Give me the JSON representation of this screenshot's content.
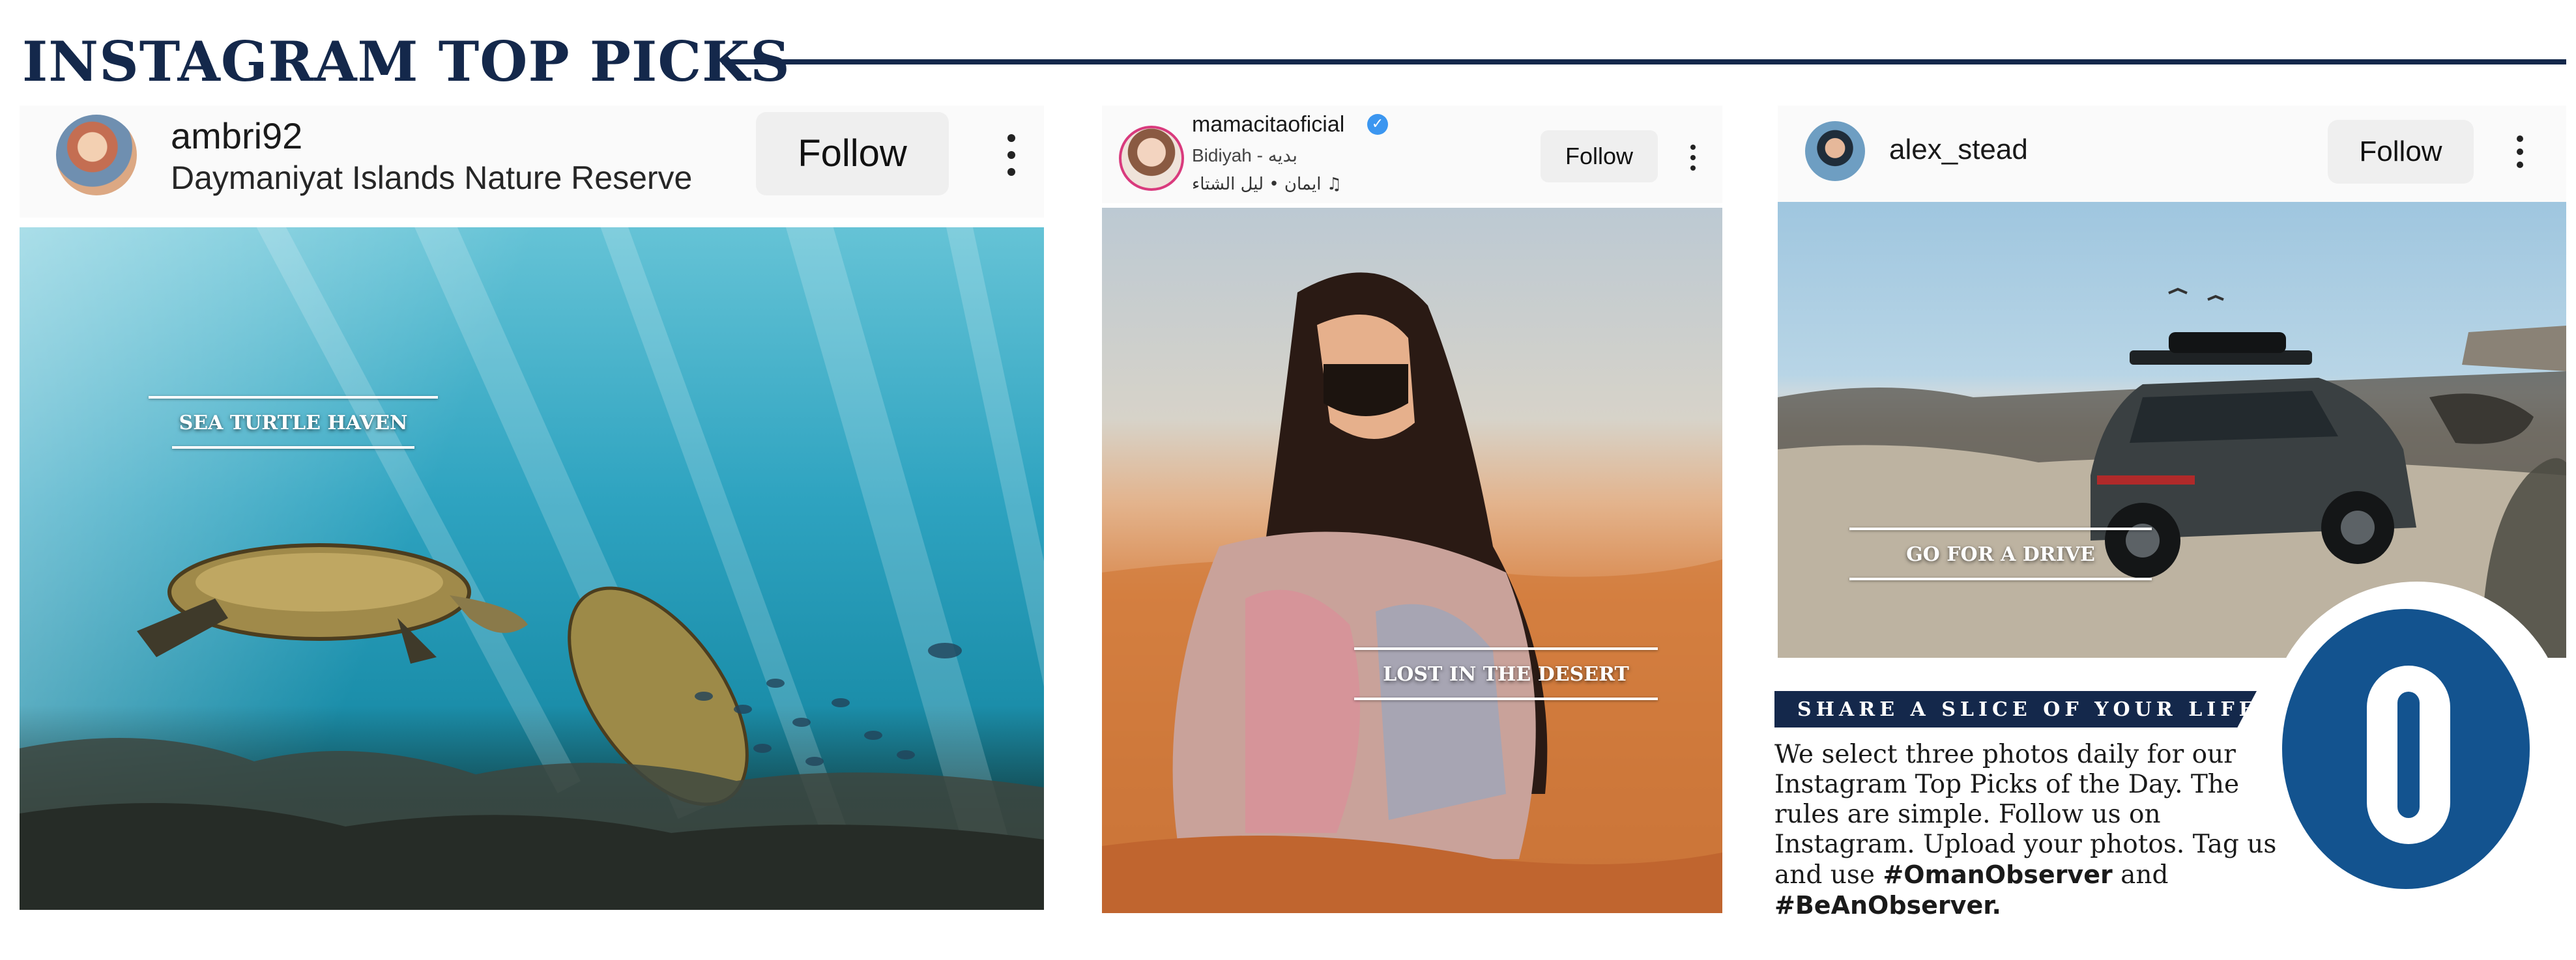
{
  "page": {
    "title": "INSTAGRAM TOP PICKS"
  },
  "posts": [
    {
      "username": "ambri92",
      "location": "Daymaniyat Islands Nature Reserve",
      "follow_label": "Follow",
      "caption": "SEA TURTLE HAVEN"
    },
    {
      "username": "mamacitaoficial",
      "location": "Bidiyah - بديه",
      "music": "ايمان • ليل الشتاء",
      "follow_label": "Follow",
      "caption": "LOST IN THE DESERT"
    },
    {
      "username": "alex_stead",
      "follow_label": "Follow",
      "caption": "GO FOR A DRIVE"
    }
  ],
  "promo": {
    "heading": "SHARE A SLICE OF YOUR LIFE",
    "body": "We select three photos daily for our Instagram Top Picks of the Day. The rules are simple. Follow us on Instagram. Upload your photos. Tag us and use",
    "hashtag1": "#OmanObserver",
    "conjunction": "and",
    "hashtag2": "#BeAnObserver."
  },
  "colors": {
    "brand_navy": "#14284b",
    "logo_blue": "#13538f",
    "verified_blue": "#3b96f0",
    "follow_button_bg": "#efefef"
  },
  "icons": [
    "more-options-icon",
    "verified-badge-icon",
    "music-note-icon",
    "oman-observer-logo"
  ]
}
